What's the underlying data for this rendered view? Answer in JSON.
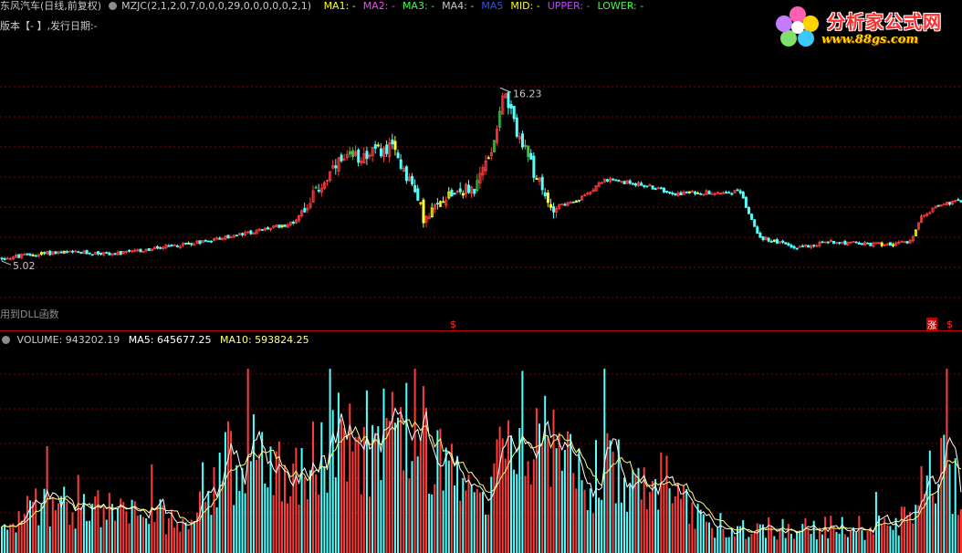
{
  "header": {
    "title": "东风汽车(日线,前复权)",
    "indicator": "MZJC(2,1,2,0,7,0,0,0,29,0,0,0,0,0,2,1)",
    "lines": [
      {
        "label": "MA1: -",
        "color": "#ffff00"
      },
      {
        "label": "MA2: -",
        "color": "#ff40ff"
      },
      {
        "label": "MA3: -",
        "color": "#40ff40"
      },
      {
        "label": "MA4: -",
        "color": "#c8c8c8"
      },
      {
        "label": "MA5",
        "color": "#3050ff"
      },
      {
        "label": "MID: -",
        "color": "#ffff00"
      },
      {
        "label": "UPPER: -",
        "color": "#c040ff"
      },
      {
        "label": "LOWER: -",
        "color": "#40ff40"
      }
    ]
  },
  "subheader": "版本【- 】,发行日期:-",
  "dll_note": "用到DLL函数",
  "markers": {
    "dollar": "$",
    "zhang": "涨"
  },
  "price_labels": {
    "high": "16.23",
    "low": "5.02"
  },
  "volume": {
    "label": "VOLUME: 943202.19",
    "ma5": "MA5: 645677.25",
    "ma10": "MA10: 593824.25"
  },
  "logo": {
    "title": "分析家公式网",
    "url": "www.88gs.com"
  },
  "colors": {
    "up": "#ff3c3c",
    "down": "#54ffff",
    "yellow_candle": "#ffff30",
    "green_candle": "#40c040",
    "grid": "#8b0000",
    "ma5_line": "#ffffff",
    "ma10_line": "#ffff80"
  }
}
